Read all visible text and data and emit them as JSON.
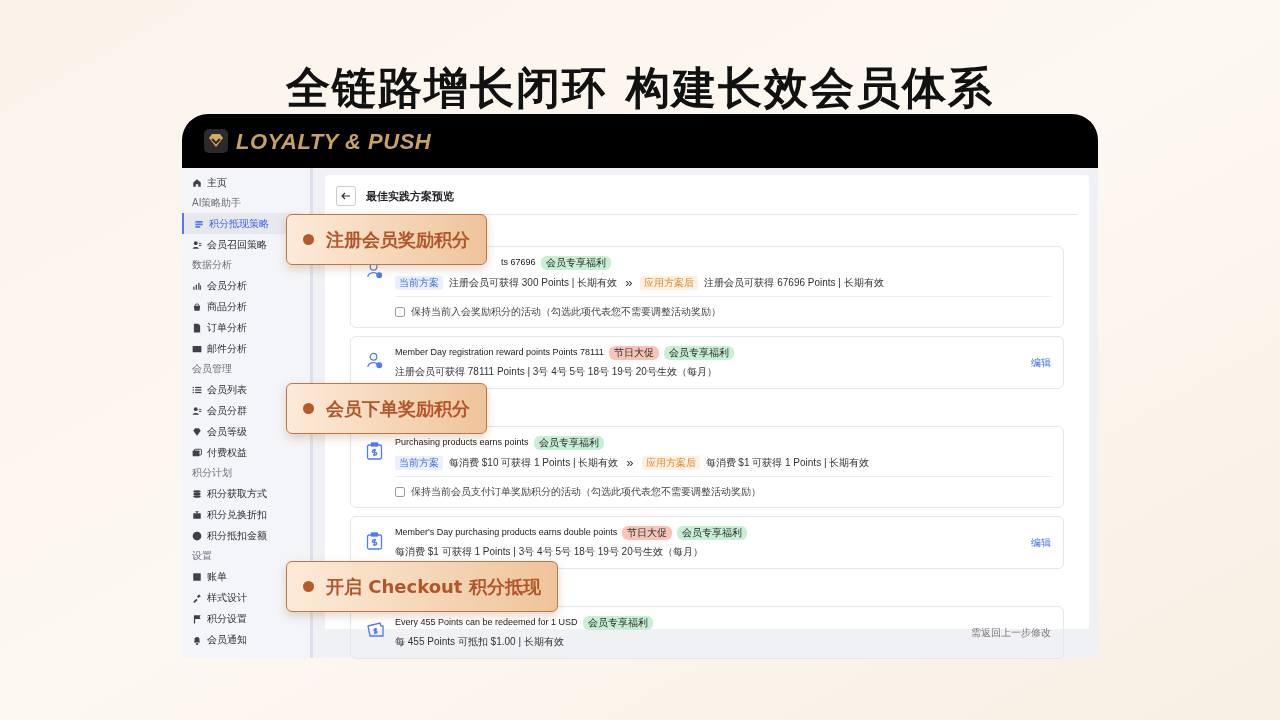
{
  "headline": "全链路增长闭环 构建长效会员体系",
  "app": {
    "brand": "LOYALTY & PUSH"
  },
  "sidebar": {
    "items": [
      {
        "kind": "item",
        "label": "主页",
        "selected": false
      },
      {
        "kind": "heading",
        "label": "AI策略助手"
      },
      {
        "kind": "item",
        "label": "积分抵现策略",
        "selected": true
      },
      {
        "kind": "item",
        "label": "会员召回策略",
        "selected": false
      },
      {
        "kind": "heading",
        "label": "数据分析"
      },
      {
        "kind": "item",
        "label": "会员分析",
        "selected": false
      },
      {
        "kind": "item",
        "label": "商品分析",
        "selected": false
      },
      {
        "kind": "item",
        "label": "订单分析",
        "selected": false
      },
      {
        "kind": "item",
        "label": "邮件分析",
        "selected": false
      },
      {
        "kind": "heading",
        "label": "会员管理"
      },
      {
        "kind": "item",
        "label": "会员列表",
        "selected": false
      },
      {
        "kind": "item",
        "label": "会员分群",
        "selected": false
      },
      {
        "kind": "item",
        "label": "会员等级",
        "selected": false
      },
      {
        "kind": "item",
        "label": "付费权益",
        "selected": false
      },
      {
        "kind": "heading",
        "label": "积分计划"
      },
      {
        "kind": "item",
        "label": "积分获取方式",
        "selected": false
      },
      {
        "kind": "item",
        "label": "积分兑换折扣",
        "selected": false
      },
      {
        "kind": "item",
        "label": "积分抵扣金额",
        "selected": false
      },
      {
        "kind": "heading",
        "label": "设置"
      },
      {
        "kind": "item",
        "label": "账单",
        "selected": false
      },
      {
        "kind": "item",
        "label": "样式设计",
        "selected": false
      },
      {
        "kind": "item",
        "label": "积分设置",
        "selected": false
      },
      {
        "kind": "item",
        "label": "会员通知",
        "selected": false
      }
    ]
  },
  "panel": {
    "title": "最佳实践方案预览",
    "sections": [
      {
        "callout": "注册会员奖励积分",
        "cards": [
          {
            "kind": "compare",
            "title": "ts 67696",
            "title_cut": true,
            "tags": [
              {
                "label": "会员专享福利",
                "color": "#c6efd3"
              }
            ],
            "current_tag": "当前方案",
            "current": "注册会员可获得 300 Points | 长期有效",
            "arrow": "»",
            "after_tag": "应用方案后",
            "after": "注册会员可获得 67696 Points | 长期有效",
            "checkbox": {
              "label": "保持当前入会奖励积分的活动（勾选此项代表您不需要调整活动奖励）",
              "checked": false
            }
          },
          {
            "kind": "rule",
            "title": "Member Day registration reward points Points 78111",
            "tags": [
              {
                "label": "节日大促",
                "color": "#f8c4b8"
              },
              {
                "label": "会员专享福利",
                "color": "#c6efd3"
              }
            ],
            "detail": "注册会员可获得 78111 Points | 3号 4号 5号 18号 19号 20号生效（每月）",
            "action": "编辑"
          }
        ]
      },
      {
        "callout": "会员下单奖励积分",
        "cards": [
          {
            "kind": "compare",
            "title": "Purchasing products earns points",
            "tags": [
              {
                "label": "会员专享福利",
                "color": "#c6efd3"
              }
            ],
            "current_tag": "当前方案",
            "current": "每消费 $10 可获得 1 Points | 长期有效",
            "arrow": "»",
            "after_tag": "应用方案后",
            "after": "每消费 $1 可获得 1 Points | 长期有效",
            "checkbox": {
              "label": "保持当前会员支付订单奖励积分的活动（勾选此项代表您不需要调整活动奖励）",
              "checked": false
            }
          },
          {
            "kind": "rule",
            "title": "Member's Day purchasing products earns double points",
            "tags": [
              {
                "label": "节日大促",
                "color": "#f8c4b8"
              },
              {
                "label": "会员专享福利",
                "color": "#c6efd3"
              }
            ],
            "detail": "每消费 $1 可获得 1 Points | 3号 4号 5号 18号 19号 20号生效（每月）",
            "action": "编辑"
          }
        ]
      },
      {
        "callout": "开启 Checkout 积分抵现",
        "cards": [
          {
            "kind": "note",
            "title": "Every 455 Points can be redeemed for 1 USD",
            "tags": [
              {
                "label": "会员专享福利",
                "color": "#c6efd3"
              }
            ],
            "detail": "每 455 Points 可抵扣 $1.00 | 长期有效",
            "note": "需返回上一步修改"
          }
        ]
      }
    ]
  }
}
